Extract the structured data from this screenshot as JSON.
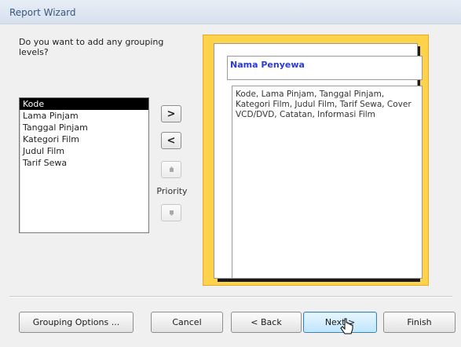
{
  "window": {
    "title": "Report Wizard"
  },
  "prompt": "Do you want to add any grouping levels?",
  "fields": [
    "Kode",
    "Lama Pinjam",
    "Tanggal Pinjam",
    "Kategori Film",
    "Judul Film",
    "Tarif Sewa"
  ],
  "selected_field": "Kode",
  "move_buttons": {
    "add": ">",
    "remove": "<",
    "up_icon": "up-arrow-icon",
    "down_icon": "down-arrow-icon"
  },
  "priority_label": "Priority",
  "preview": {
    "group_field": "Nama Penyewa",
    "detail_fields": "Kode, Lama Pinjam, Tanggal Pinjam, Kategori Film, Judul Film, Tarif Sewa, Cover VCD/DVD, Catatan, Informasi Film"
  },
  "buttons": {
    "grouping_options": "Grouping Options ...",
    "cancel": "Cancel",
    "back": "< Back",
    "next": "Next >",
    "finish": "Finish"
  },
  "colors": {
    "preview_background": "#fed24a",
    "group_title": "#2a3ad6",
    "selection": "#000000"
  }
}
